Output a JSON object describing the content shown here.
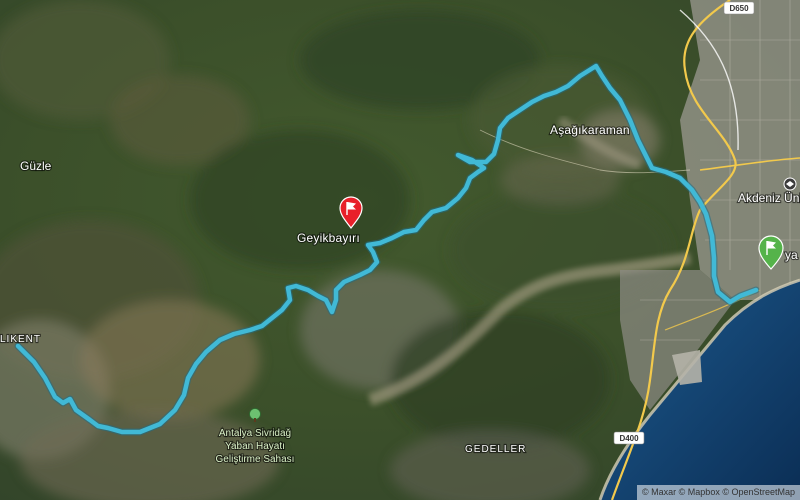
{
  "map": {
    "attribution": "© Maxar © Mapbox © OpenStreetMap",
    "colors": {
      "route": "#41b9d6",
      "start_marker": "#e8202a",
      "end_marker": "#55b34a",
      "sea": "#0f3d6b",
      "road": "#f2c94c"
    },
    "labels": {
      "guzle": "Güzle",
      "likent": "LIKENT",
      "geyikbayiri": "Geyikbayırı",
      "asagikaraman": "Aşağıkaraman",
      "akdeniz": "Akdeniz Üni",
      "konyaalti_partial": "ya",
      "park_line1": "Antalya Sivridağ",
      "park_line2": "Yaban Hayatı",
      "park_line3": "Geliştirme Sahası",
      "gedeller": "GEDELLER"
    },
    "road_shields": {
      "top": "D650",
      "bottom": "D400"
    },
    "markers": {
      "start": "flag-red",
      "end": "flag-green",
      "park": "tree-icon",
      "university": "graduation-cap-icon"
    }
  }
}
